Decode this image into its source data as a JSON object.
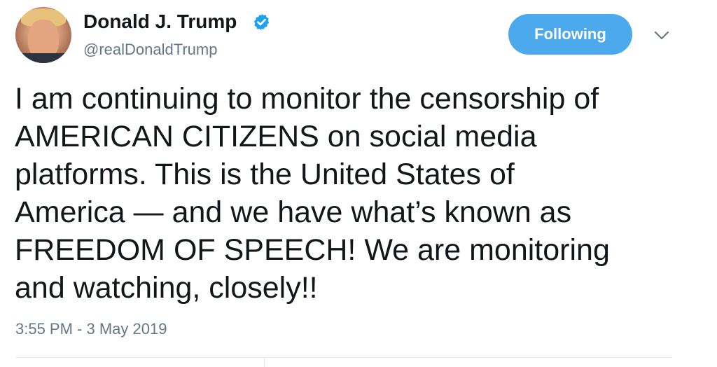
{
  "author": {
    "display_name": "Donald J. Trump",
    "handle": "@realDonaldTrump",
    "verified": true
  },
  "follow_button": {
    "label": "Following"
  },
  "tweet": {
    "text": "I am continuing to monitor the censorship of\nAMERICAN CITIZENS on social media\nplatforms. This is the United States of\nAmerica — and we have what’s known as\nFREEDOM OF SPEECH! We are monitoring\nand watching, closely!!",
    "timestamp": "3:55 PM - 3 May 2019"
  },
  "colors": {
    "accent": "#4ba9ec",
    "verified_badge": "#1da1f2",
    "secondary_text": "#657786",
    "primary_text": "#14171a"
  },
  "icons": {
    "verified": "verified-badge-icon",
    "caret": "chevron-down-icon"
  }
}
